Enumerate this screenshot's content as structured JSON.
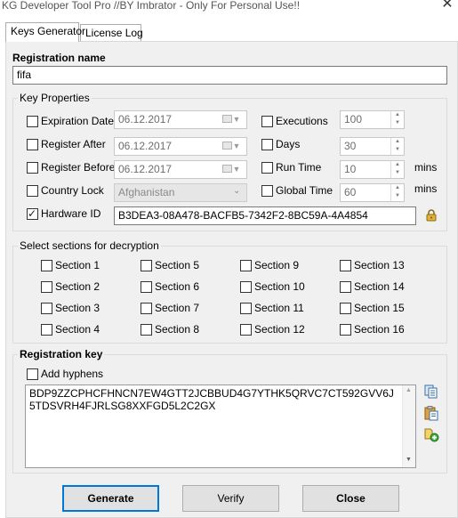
{
  "window": {
    "title": "KG Developer Tool Pro //BY Imbrator  - Only For Personal Use!!",
    "close_glyph": "✕"
  },
  "tabs": [
    {
      "label": "Keys Generator",
      "active": true
    },
    {
      "label": "License Log",
      "active": false
    }
  ],
  "registration_name": {
    "label": "Registration name",
    "value": "fifa"
  },
  "key_properties": {
    "title": "Key Properties",
    "expiration_date": {
      "label": "Expiration Date",
      "checked": false,
      "date": "06.12.2017"
    },
    "register_after": {
      "label": "Register After",
      "checked": false,
      "date": "06.12.2017"
    },
    "register_before": {
      "label": "Register Before",
      "checked": false,
      "date": "06.12.2017"
    },
    "country_lock": {
      "label": "Country Lock",
      "checked": false,
      "country": "Afghanistan"
    },
    "hardware_id": {
      "label": "Hardware ID",
      "checked": true,
      "value": "B3DEA3-08A478-BACFB5-7342F2-8BC59A-4A4854"
    },
    "executions": {
      "label": "Executions",
      "checked": false,
      "value": "100"
    },
    "days": {
      "label": "Days",
      "checked": false,
      "value": "30"
    },
    "run_time": {
      "label": "Run Time",
      "checked": false,
      "value": "10",
      "unit": "mins"
    },
    "global_time": {
      "label": "Global Time",
      "checked": false,
      "value": "60",
      "unit": "mins"
    }
  },
  "sections": {
    "title": "Select sections for decryption",
    "items": [
      "Section 1",
      "Section 2",
      "Section 3",
      "Section 4",
      "Section 5",
      "Section 6",
      "Section 7",
      "Section 8",
      "Section 9",
      "Section 10",
      "Section 11",
      "Section 12",
      "Section 13",
      "Section 14",
      "Section 15",
      "Section 16"
    ]
  },
  "registration_key": {
    "title": "Registration key",
    "add_hyphens_label": "Add hyphens",
    "add_hyphens_checked": false,
    "value": "BDP9ZZCPHCFHNCN7EW4GTT2JCBBUD4G7YTHK5QRVC7CT592GVV6J5TDSVRH4FJRLSG8XXFGD5L2C2GX"
  },
  "buttons": {
    "generate": "Generate",
    "verify": "Verify",
    "close": "Close"
  },
  "icons": {
    "hardware_lookup": "lock-icon",
    "copy": "copy-icon",
    "paste": "paste-icon",
    "add": "add-icon"
  }
}
